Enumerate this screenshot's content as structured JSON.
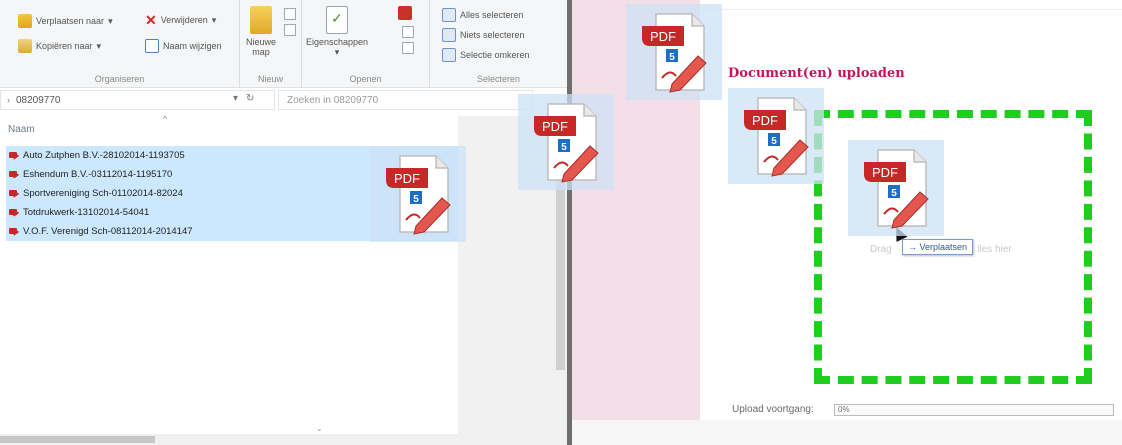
{
  "explorer": {
    "ribbon": {
      "move_to": "Verplaatsen naar",
      "delete": "Verwijderen",
      "copy_to": "Kopiëren naar",
      "rename": "Naam wijzigen",
      "new_folder": "Nieuwe map",
      "properties": "Eigenschappen",
      "select_all": "Alles selecteren",
      "select_none": "Niets selecteren",
      "invert_selection": "Selectie omkeren",
      "groups": {
        "organize": "Organiseren",
        "new": "Nieuw",
        "open": "Openen",
        "select": "Selecteren"
      }
    },
    "address": "08209770",
    "search_placeholder": "Zoeken in 08209770",
    "column_name": "Naam",
    "files": [
      "Auto Zutphen B.V.-28102014-1193705",
      "Eshendum B.V.-03112014-1195170",
      "Sportvereniging Sch-01102014-82024",
      "Totdrukwerk-13102014-54041",
      "V.O.F. Verenigd Sch-08112014-2014147"
    ]
  },
  "page": {
    "upload_title": "Document(en) uploaden",
    "drop_hint_left": "Drag",
    "drop_hint_right": "iles hier",
    "move_tooltip": "→ Verplaatsen",
    "progress_label": "Upload voortgang:",
    "progress_text": "0%",
    "progress": 0
  },
  "drag_icon": {
    "badge": "PDF",
    "number": "5"
  },
  "colors": {
    "selection": "#cce8ff",
    "dropzone_border": "#1fcc1f",
    "title": "#c2175b",
    "pdf_red": "#c62828"
  }
}
